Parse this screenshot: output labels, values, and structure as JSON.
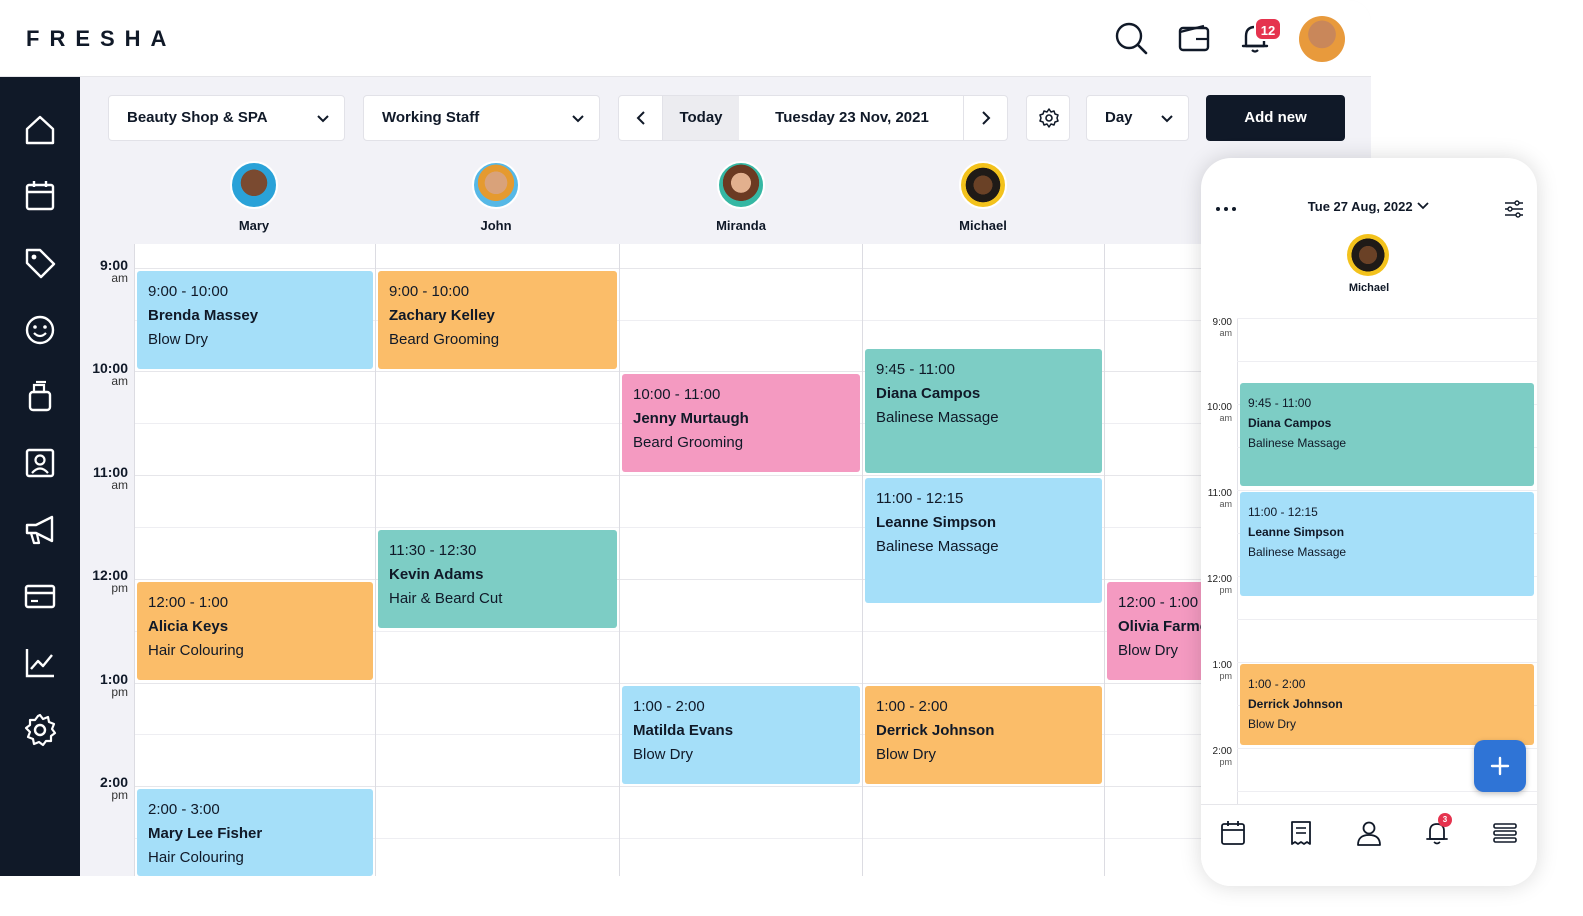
{
  "app": {
    "logo": "FRESHA"
  },
  "header": {
    "notification_count": "12"
  },
  "toolbar": {
    "location": "Beauty Shop & SPA",
    "staff_filter": "Working Staff",
    "today": "Today",
    "date": "Tuesday 23 Nov, 2021",
    "view": "Day",
    "add_new": "Add new"
  },
  "staff": [
    {
      "name": "Mary"
    },
    {
      "name": "John"
    },
    {
      "name": "Miranda"
    },
    {
      "name": "Michael"
    }
  ],
  "times": [
    {
      "hour": "9:00",
      "ampm": "am"
    },
    {
      "hour": "10:00",
      "ampm": "am"
    },
    {
      "hour": "11:00",
      "ampm": "am"
    },
    {
      "hour": "12:00",
      "ampm": "pm"
    },
    {
      "hour": "1:00",
      "ampm": "pm"
    },
    {
      "hour": "2:00",
      "ampm": "pm"
    }
  ],
  "appointments": [
    {
      "time": "9:00 - 10:00",
      "client": "Brenda Massey",
      "service": "Blow Dry",
      "color": "#a5dff9"
    },
    {
      "time": "9:00 - 10:00",
      "client": "Zachary Kelley",
      "service": "Beard Grooming",
      "color": "#fbbd69"
    },
    {
      "time": "10:00 - 11:00",
      "client": "Jenny Murtaugh",
      "service": "Beard Grooming",
      "color": "#f49ac1"
    },
    {
      "time": "9:45 - 11:00",
      "client": "Diana Campos",
      "service": "Balinese Massage",
      "color": "#7dcdc5"
    },
    {
      "time": "11:00 - 12:15",
      "client": "Leanne Simpson",
      "service": "Balinese Massage",
      "color": "#a5dff9"
    },
    {
      "time": "11:30 - 12:30",
      "client": "Kevin Adams",
      "service": "Hair & Beard Cut",
      "color": "#7dcdc5"
    },
    {
      "time": "12:00 - 1:00",
      "client": "Alicia Keys",
      "service": "Hair Colouring",
      "color": "#fbbd69"
    },
    {
      "time": "12:00 - 1:00",
      "client": "Olivia Farmer",
      "service": "Blow Dry",
      "color": "#f49ac1"
    },
    {
      "time": "1:00 - 2:00",
      "client": "Matilda Evans",
      "service": "Blow Dry",
      "color": "#a5dff9"
    },
    {
      "time": "1:00 - 2:00",
      "client": "Derrick Johnson",
      "service": "Blow Dry",
      "color": "#fbbd69"
    },
    {
      "time": "2:00 - 3:00",
      "client": "Mary Lee Fisher",
      "service": "Hair Colouring",
      "color": "#a5dff9"
    }
  ],
  "mobile": {
    "date": "Tue 27 Aug, 2022",
    "staff_name": "Michael",
    "notification_count": "3",
    "times": [
      {
        "hour": "9:00",
        "ampm": "am"
      },
      {
        "hour": "10:00",
        "ampm": "am"
      },
      {
        "hour": "11:00",
        "ampm": "am"
      },
      {
        "hour": "12:00",
        "ampm": "pm"
      },
      {
        "hour": "1:00",
        "ampm": "pm"
      },
      {
        "hour": "2:00",
        "ampm": "pm"
      }
    ],
    "appointments": [
      {
        "time": "9:45 - 11:00",
        "client": "Diana Campos",
        "service": "Balinese Massage",
        "color": "#7dcdc5"
      },
      {
        "time": "11:00 - 12:15",
        "client": "Leanne Simpson",
        "service": "Balinese Massage",
        "color": "#a5dff9"
      },
      {
        "time": "1:00 - 2:00",
        "client": "Derrick Johnson",
        "service": "Blow Dry",
        "color": "#fbbd69"
      }
    ]
  },
  "icons": {
    "header": [
      "search-icon",
      "wallet-icon",
      "bell-icon"
    ],
    "sidebar": [
      "home-icon",
      "calendar-icon",
      "tag-icon",
      "smiley-icon",
      "product-bottle-icon",
      "contact-card-icon",
      "megaphone-icon",
      "credit-card-icon",
      "chart-icon",
      "settings-gear-icon"
    ],
    "mobile_nav": [
      "calendar-icon",
      "receipt-icon",
      "user-icon",
      "bell-icon",
      "menu-icon"
    ]
  },
  "colors": {
    "dark": "#101928",
    "accent_blue": "#2f74d6",
    "badge_red": "#e5334e"
  }
}
